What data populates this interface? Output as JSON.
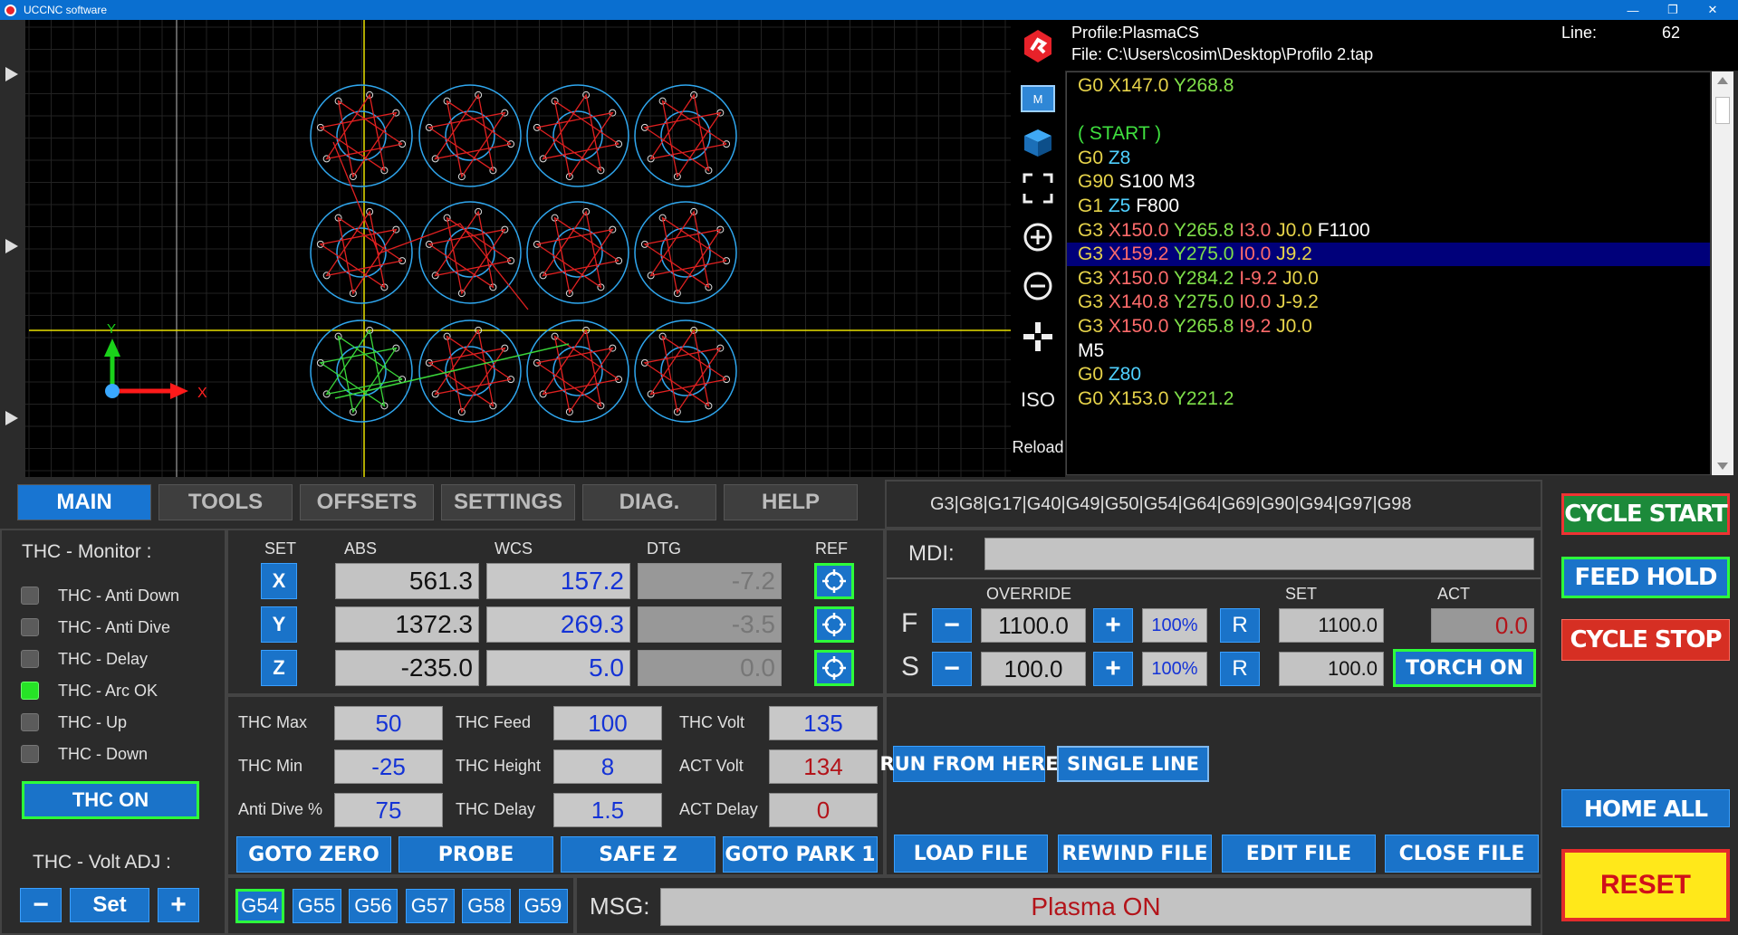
{
  "window": {
    "title": "UCCNC software",
    "minimize": "—",
    "restore": "❐",
    "close": "✕"
  },
  "toolbar": {
    "iso_label": "ISO",
    "reload_label": "Reload"
  },
  "file_header": {
    "profile": "Profile:PlasmaCS",
    "file": "File:  C:\\Users\\cosim\\Desktop\\Profilo 2.tap",
    "line_label": "Line:",
    "line_value": "62"
  },
  "gcode_lines": [
    {
      "parts": [
        {
          "t": "G0 ",
          "c": "#e6d34a"
        },
        {
          "t": "X147.0 ",
          "c": "#e6d34a"
        },
        {
          "t": "Y268.8",
          "c": "#7fe04a"
        }
      ]
    },
    {
      "parts": []
    },
    {
      "parts": [
        {
          "t": "( START )",
          "c": "#3fe03f"
        }
      ]
    },
    {
      "parts": [
        {
          "t": "G0 ",
          "c": "#e6d34a"
        },
        {
          "t": "Z8",
          "c": "#4fd0ff"
        }
      ]
    },
    {
      "parts": [
        {
          "t": "G90 ",
          "c": "#e6d34a"
        },
        {
          "t": "S100 M3",
          "c": "#ffffff"
        }
      ]
    },
    {
      "parts": [
        {
          "t": "G1 ",
          "c": "#e6d34a"
        },
        {
          "t": "Z5 ",
          "c": "#4fd0ff"
        },
        {
          "t": "F800",
          "c": "#ffffff"
        }
      ]
    },
    {
      "parts": [
        {
          "t": "G3 ",
          "c": "#e6d34a"
        },
        {
          "t": "X150.0 ",
          "c": "#ff6b6b"
        },
        {
          "t": "Y265.8 ",
          "c": "#7fe04a"
        },
        {
          "t": "I3.0 ",
          "c": "#ff6b6b"
        },
        {
          "t": "J0.0 ",
          "c": "#e6d34a"
        },
        {
          "t": "F1100",
          "c": "#ffffff"
        }
      ]
    },
    {
      "parts": [
        {
          "t": "G3 ",
          "c": "#e6d34a"
        },
        {
          "t": "X159.2 ",
          "c": "#ff6b6b"
        },
        {
          "t": "Y275.0 ",
          "c": "#7fe04a"
        },
        {
          "t": "I0.0 ",
          "c": "#ff6b6b"
        },
        {
          "t": "J9.2",
          "c": "#e6d34a"
        }
      ],
      "highlight": true
    },
    {
      "parts": [
        {
          "t": "G3 ",
          "c": "#e6d34a"
        },
        {
          "t": "X150.0 ",
          "c": "#ff6b6b"
        },
        {
          "t": "Y284.2 ",
          "c": "#7fe04a"
        },
        {
          "t": "I-9.2 ",
          "c": "#ff6b6b"
        },
        {
          "t": "J0.0",
          "c": "#e6d34a"
        }
      ]
    },
    {
      "parts": [
        {
          "t": "G3 ",
          "c": "#e6d34a"
        },
        {
          "t": "X140.8 ",
          "c": "#ff6b6b"
        },
        {
          "t": "Y275.0 ",
          "c": "#7fe04a"
        },
        {
          "t": "I0.0 ",
          "c": "#ff6b6b"
        },
        {
          "t": "J-9.2",
          "c": "#e6d34a"
        }
      ]
    },
    {
      "parts": [
        {
          "t": "G3 ",
          "c": "#e6d34a"
        },
        {
          "t": "X150.0 ",
          "c": "#ff6b6b"
        },
        {
          "t": "Y265.8 ",
          "c": "#7fe04a"
        },
        {
          "t": "I9.2 ",
          "c": "#ff6b6b"
        },
        {
          "t": "J0.0",
          "c": "#e6d34a"
        }
      ]
    },
    {
      "parts": [
        {
          "t": "M5",
          "c": "#ffffff"
        }
      ]
    },
    {
      "parts": [
        {
          "t": "G0 ",
          "c": "#e6d34a"
        },
        {
          "t": "Z80",
          "c": "#4fd0ff"
        }
      ]
    },
    {
      "parts": [
        {
          "t": "G0 ",
          "c": "#e6d34a"
        },
        {
          "t": "X153.0 ",
          "c": "#e6d34a"
        },
        {
          "t": "Y221.2",
          "c": "#7fe04a"
        }
      ]
    }
  ],
  "tabs": [
    "MAIN",
    "TOOLS",
    "OFFSETS",
    "SETTINGS",
    "DIAG.",
    "HELP"
  ],
  "modal_codes": "G3|G8|G17|G40|G49|G50|G54|G64|G69|G90|G94|G97|G98",
  "thc_monitor": {
    "title": "THC - Monitor :",
    "items": [
      {
        "label": "THC - Anti Down",
        "on": false
      },
      {
        "label": "THC - Anti Dive",
        "on": false
      },
      {
        "label": "THC - Delay",
        "on": false
      },
      {
        "label": "THC - Arc OK",
        "on": true
      },
      {
        "label": "THC - Up",
        "on": false
      },
      {
        "label": "THC - Down",
        "on": false
      }
    ],
    "thc_on_label": "THC ON",
    "volt_adj_title": "THC - Volt ADJ :",
    "minus": "−",
    "set": "Set",
    "plus": "+"
  },
  "dro": {
    "headers": {
      "set": "SET",
      "abs": "ABS",
      "wcs": "WCS",
      "dtg": "DTG",
      "ref": "REF"
    },
    "axes": [
      {
        "name": "X",
        "abs": "561.3",
        "wcs": "157.2",
        "dtg": "-7.2"
      },
      {
        "name": "Y",
        "abs": "1372.3",
        "wcs": "269.3",
        "dtg": "-3.5"
      },
      {
        "name": "Z",
        "abs": "-235.0",
        "wcs": "5.0",
        "dtg": "0.0"
      }
    ]
  },
  "thc_params": {
    "thc_max_label": "THC Max",
    "thc_max": "50",
    "thc_feed_label": "THC Feed",
    "thc_feed": "100",
    "thc_volt_label": "THC Volt",
    "thc_volt": "135",
    "thc_min_label": "THC Min",
    "thc_min": "-25",
    "thc_height_label": "THC Height",
    "thc_height": "8",
    "act_volt_label": "ACT Volt",
    "act_volt": "134",
    "anti_dive_label": "Anti Dive %",
    "anti_dive": "75",
    "thc_delay_label": "THC Delay",
    "thc_delay": "1.5",
    "act_delay_label": "ACT Delay",
    "act_delay": "0"
  },
  "goto": {
    "zero": "GOTO ZERO",
    "probe": "PROBE",
    "safez": "SAFE Z",
    "park": "GOTO PARK 1"
  },
  "wcs_buttons": [
    "G54",
    "G55",
    "G56",
    "G57",
    "G58",
    "G59"
  ],
  "mdi": {
    "label": "MDI:",
    "value": ""
  },
  "override": {
    "override_label": "OVERRIDE",
    "set_label": "SET",
    "act_label": "ACT",
    "f_label": "F",
    "f_value": "1100.0",
    "f_pct": "100%",
    "f_set": "1100.0",
    "f_act": "0.0",
    "s_label": "S",
    "s_value": "100.0",
    "s_pct": "100%",
    "s_set": "100.0",
    "minus": "−",
    "plus": "+",
    "r": "R",
    "torch_on": "TORCH ON"
  },
  "run": {
    "run_from_here": "RUN FROM HERE",
    "single_line": "SINGLE LINE"
  },
  "file_ops": {
    "load": "LOAD FILE",
    "rewind": "REWIND FILE",
    "edit": "EDIT FILE",
    "close": "CLOSE FILE"
  },
  "msg": {
    "label": "MSG:",
    "value": "Plasma ON"
  },
  "controls": {
    "cycle_start": "CYCLE START",
    "feed_hold": "FEED HOLD",
    "cycle_stop": "CYCLE STOP",
    "home_all": "HOME ALL",
    "reset": "RESET"
  },
  "viewport": {
    "x_axis": "X",
    "y_axis": "Y"
  },
  "colors": {
    "accent": "#1a73c9",
    "green_border": "#2dff3b",
    "cycle_stop": "#d62f23",
    "reset": "#ffe81a"
  }
}
